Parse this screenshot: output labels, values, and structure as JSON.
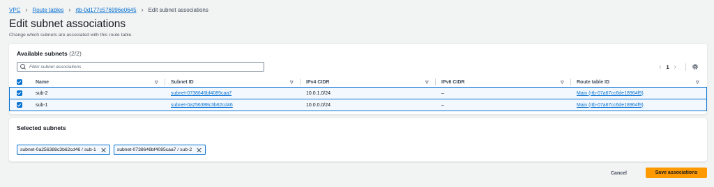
{
  "breadcrumb": {
    "items": [
      "VPC",
      "Route tables",
      "rtb-0d177c576996e0645"
    ],
    "current": "Edit subnet associations"
  },
  "page": {
    "title": "Edit subnet associations",
    "description": "Change which subnets are associated with this route table."
  },
  "available_subnets": {
    "title": "Available subnets",
    "count": "(2/2)",
    "search_placeholder": "Filter subnet associations",
    "page_number": "1",
    "columns": [
      "Name",
      "Subnet ID",
      "IPv4 CIDR",
      "IPv6 CIDR",
      "Route table ID"
    ],
    "rows": [
      {
        "name": "sub-2",
        "subnet_id": "subnet-0738646bf4085caa7",
        "ipv4": "10.0.1.0/24",
        "ipv6": "–",
        "route_table": "Main (rtb-07a67cc6de18964f9)"
      },
      {
        "name": "sub-1",
        "subnet_id": "subnet-0a256388c3b62cd46",
        "ipv4": "10.0.0.0/24",
        "ipv6": "–",
        "route_table": "Main (rtb-07a67cc6de18964f9)"
      }
    ]
  },
  "selected_subnets": {
    "title": "Selected subnets",
    "tokens": [
      "subnet-0a256388c3b62cd46 / sub-1",
      "subnet-0738646bf4085caa7 / sub-2"
    ]
  },
  "actions": {
    "cancel": "Cancel",
    "save": "Save associations"
  },
  "colors": {
    "link": "#0972d3",
    "primary_button": "#ff9900",
    "selected_row": "#f2f8fd"
  }
}
